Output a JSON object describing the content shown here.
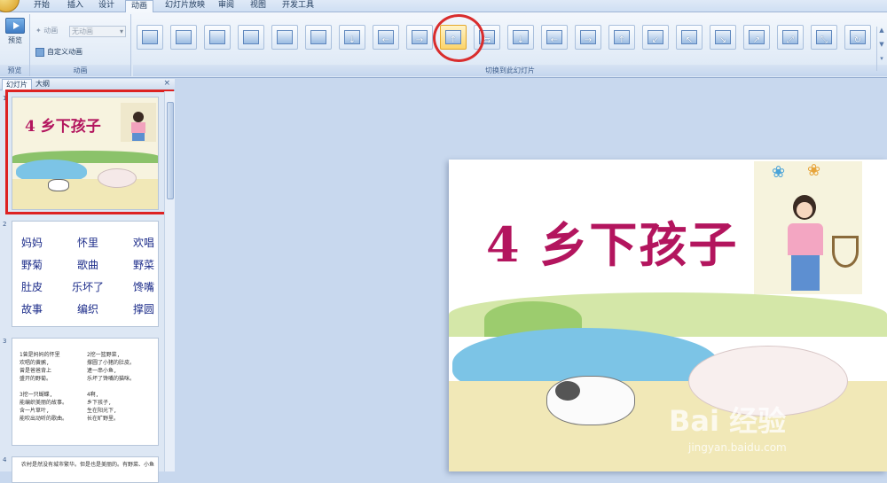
{
  "tabs": [
    {
      "label": "开始",
      "active": false
    },
    {
      "label": "插入",
      "active": false
    },
    {
      "label": "设计",
      "active": false
    },
    {
      "label": "动画",
      "active": true
    },
    {
      "label": "幻灯片放映",
      "active": false
    },
    {
      "label": "审阅",
      "active": false
    },
    {
      "label": "视图",
      "active": false
    },
    {
      "label": "开发工具",
      "active": false
    }
  ],
  "ribbon": {
    "preview": {
      "button_label": "预览",
      "group_label": "预览"
    },
    "animation": {
      "anim_label": "动画",
      "anim_value": "无动画",
      "custom_label": "自定义动画",
      "group_label": "动画"
    },
    "transitions": {
      "group_label": "切换到此幻灯片",
      "buttons": [
        {
          "name": "no-transition",
          "arrow": ""
        },
        {
          "name": "fade-smooth",
          "arrow": ""
        },
        {
          "name": "fade-through-black",
          "arrow": ""
        },
        {
          "name": "cut",
          "arrow": ""
        },
        {
          "name": "cut-through-black",
          "arrow": ""
        },
        {
          "name": "dissolve",
          "arrow": ""
        },
        {
          "name": "wipe-down",
          "arrow": "↓"
        },
        {
          "name": "wipe-left",
          "arrow": "←"
        },
        {
          "name": "wipe-right",
          "arrow": "→"
        },
        {
          "name": "wipe-up",
          "arrow": "↑",
          "selected": true
        },
        {
          "name": "split-horizontal",
          "arrow": "⇆"
        },
        {
          "name": "push-down",
          "arrow": "↓"
        },
        {
          "name": "push-left",
          "arrow": "←"
        },
        {
          "name": "push-right",
          "arrow": "→"
        },
        {
          "name": "push-up",
          "arrow": "↑"
        },
        {
          "name": "cover-down-left",
          "arrow": "↙"
        },
        {
          "name": "cover-up-left",
          "arrow": "↖"
        },
        {
          "name": "cover-down-right",
          "arrow": "↘"
        },
        {
          "name": "cover-up-right",
          "arrow": "↗"
        },
        {
          "name": "zoom-in",
          "arrow": "⤢"
        },
        {
          "name": "zoom-out",
          "arrow": "⤡"
        },
        {
          "name": "wheel",
          "arrow": "↻"
        }
      ]
    }
  },
  "panel": {
    "tab_slides": "幻灯片",
    "tab_outline": "大纲",
    "close": "×"
  },
  "slides": [
    {
      "num": "1",
      "title": "4 乡下孩子"
    },
    {
      "num": "2",
      "vocab": [
        [
          "妈妈",
          "怀里",
          "欢唱"
        ],
        [
          "野菊",
          "歌曲",
          "野菜"
        ],
        [
          "肚皮",
          "乐坏了",
          "馋嘴"
        ],
        [
          "故事",
          "编织",
          "撑圆"
        ]
      ]
    },
    {
      "num": "3",
      "poem_left": "1曾是妈妈的怀里\n欢唱的黄鹂,\n曾是爸爸背上\n盛开的野菊。\n\n3挖一只蝴蝶,\n能编织美丽的故事。\n含一片草叶,\n能吹出动听的歌曲。",
      "poem_right": "2挖一篮野菜,\n撑圆了小猪的肚皮。\n逮一串小鱼,\n乐坏了馋嘴的猫咪。\n\n4啊,\n乡下孩子,\n生在阳光下,\n长在旷野里。"
    },
    {
      "num": "4",
      "text": "农村是然没有城市繁华。但是也是美丽的。有野菜、小鱼"
    }
  ],
  "main_slide": {
    "title": "4 乡下孩子",
    "watermark": "Bai 经验",
    "watermark_url": "jingyan.baidu.com"
  }
}
